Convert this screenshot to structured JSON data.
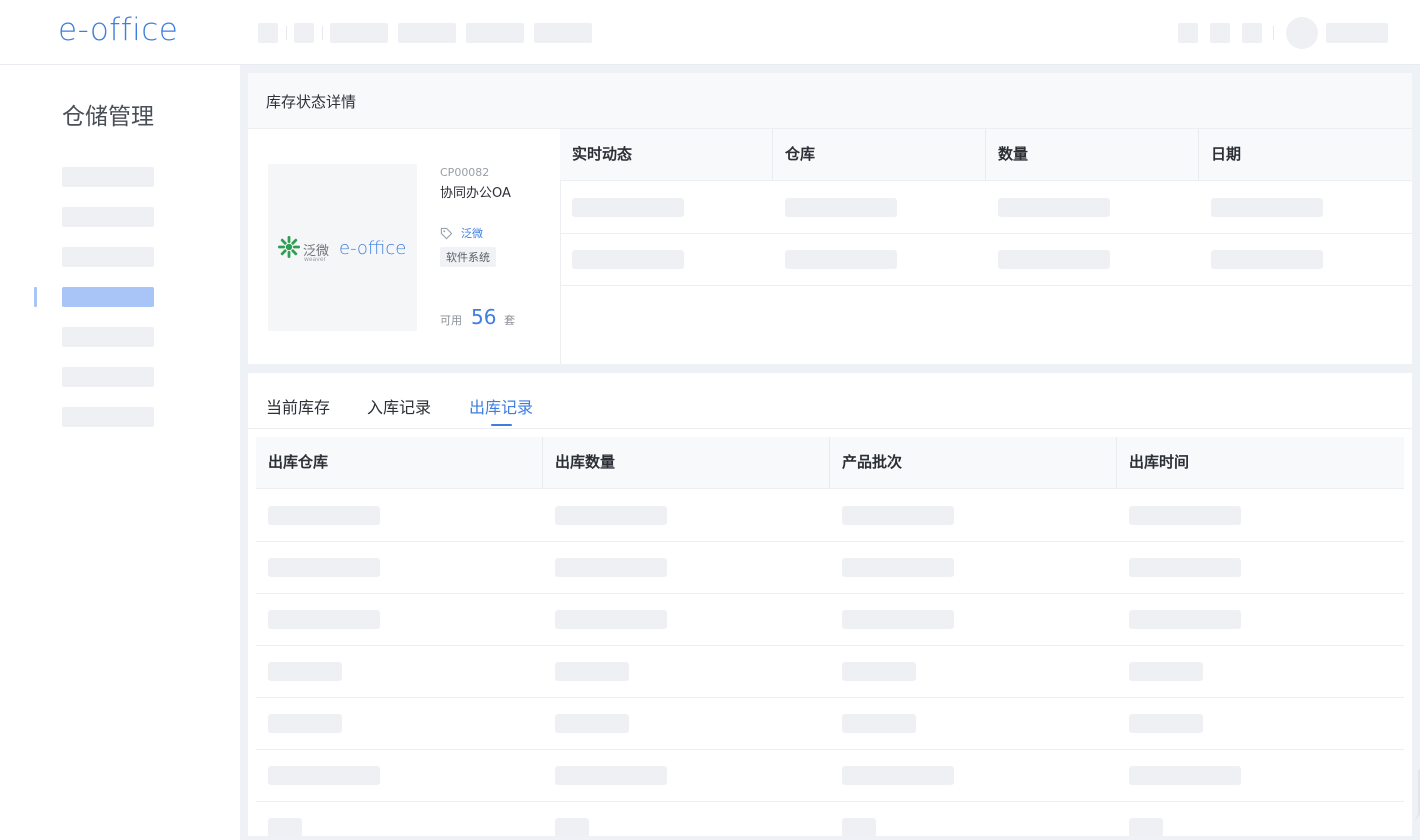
{
  "header": {
    "logo_text": "e-office"
  },
  "sidebar": {
    "module_title": "仓储管理",
    "active_index": 3
  },
  "detail": {
    "title": "库存状态详情",
    "product": {
      "image_brand_cn": "泛微",
      "image_brand_en": "weaver",
      "image_product": "e-office",
      "code": "CP00082",
      "name": "协同办公OA",
      "brand": "泛微",
      "category": "软件系统",
      "available_label": "可用",
      "available_count": "56",
      "available_unit": "套"
    },
    "dynamics_table": {
      "headers": [
        "实时动态",
        "仓库",
        "数量",
        "日期"
      ]
    }
  },
  "records": {
    "tabs": [
      {
        "label": "当前库存",
        "active": false
      },
      {
        "label": "入库记录",
        "active": false
      },
      {
        "label": "出库记录",
        "active": true
      }
    ],
    "table": {
      "headers": [
        "出库仓库",
        "出库数量",
        "产品批次",
        "出库时间"
      ]
    }
  },
  "colors": {
    "accent": "#3f7ee0",
    "active_nav": "#a9c4f6",
    "placeholder": "#eef0f3",
    "background": "#eef1f6"
  }
}
